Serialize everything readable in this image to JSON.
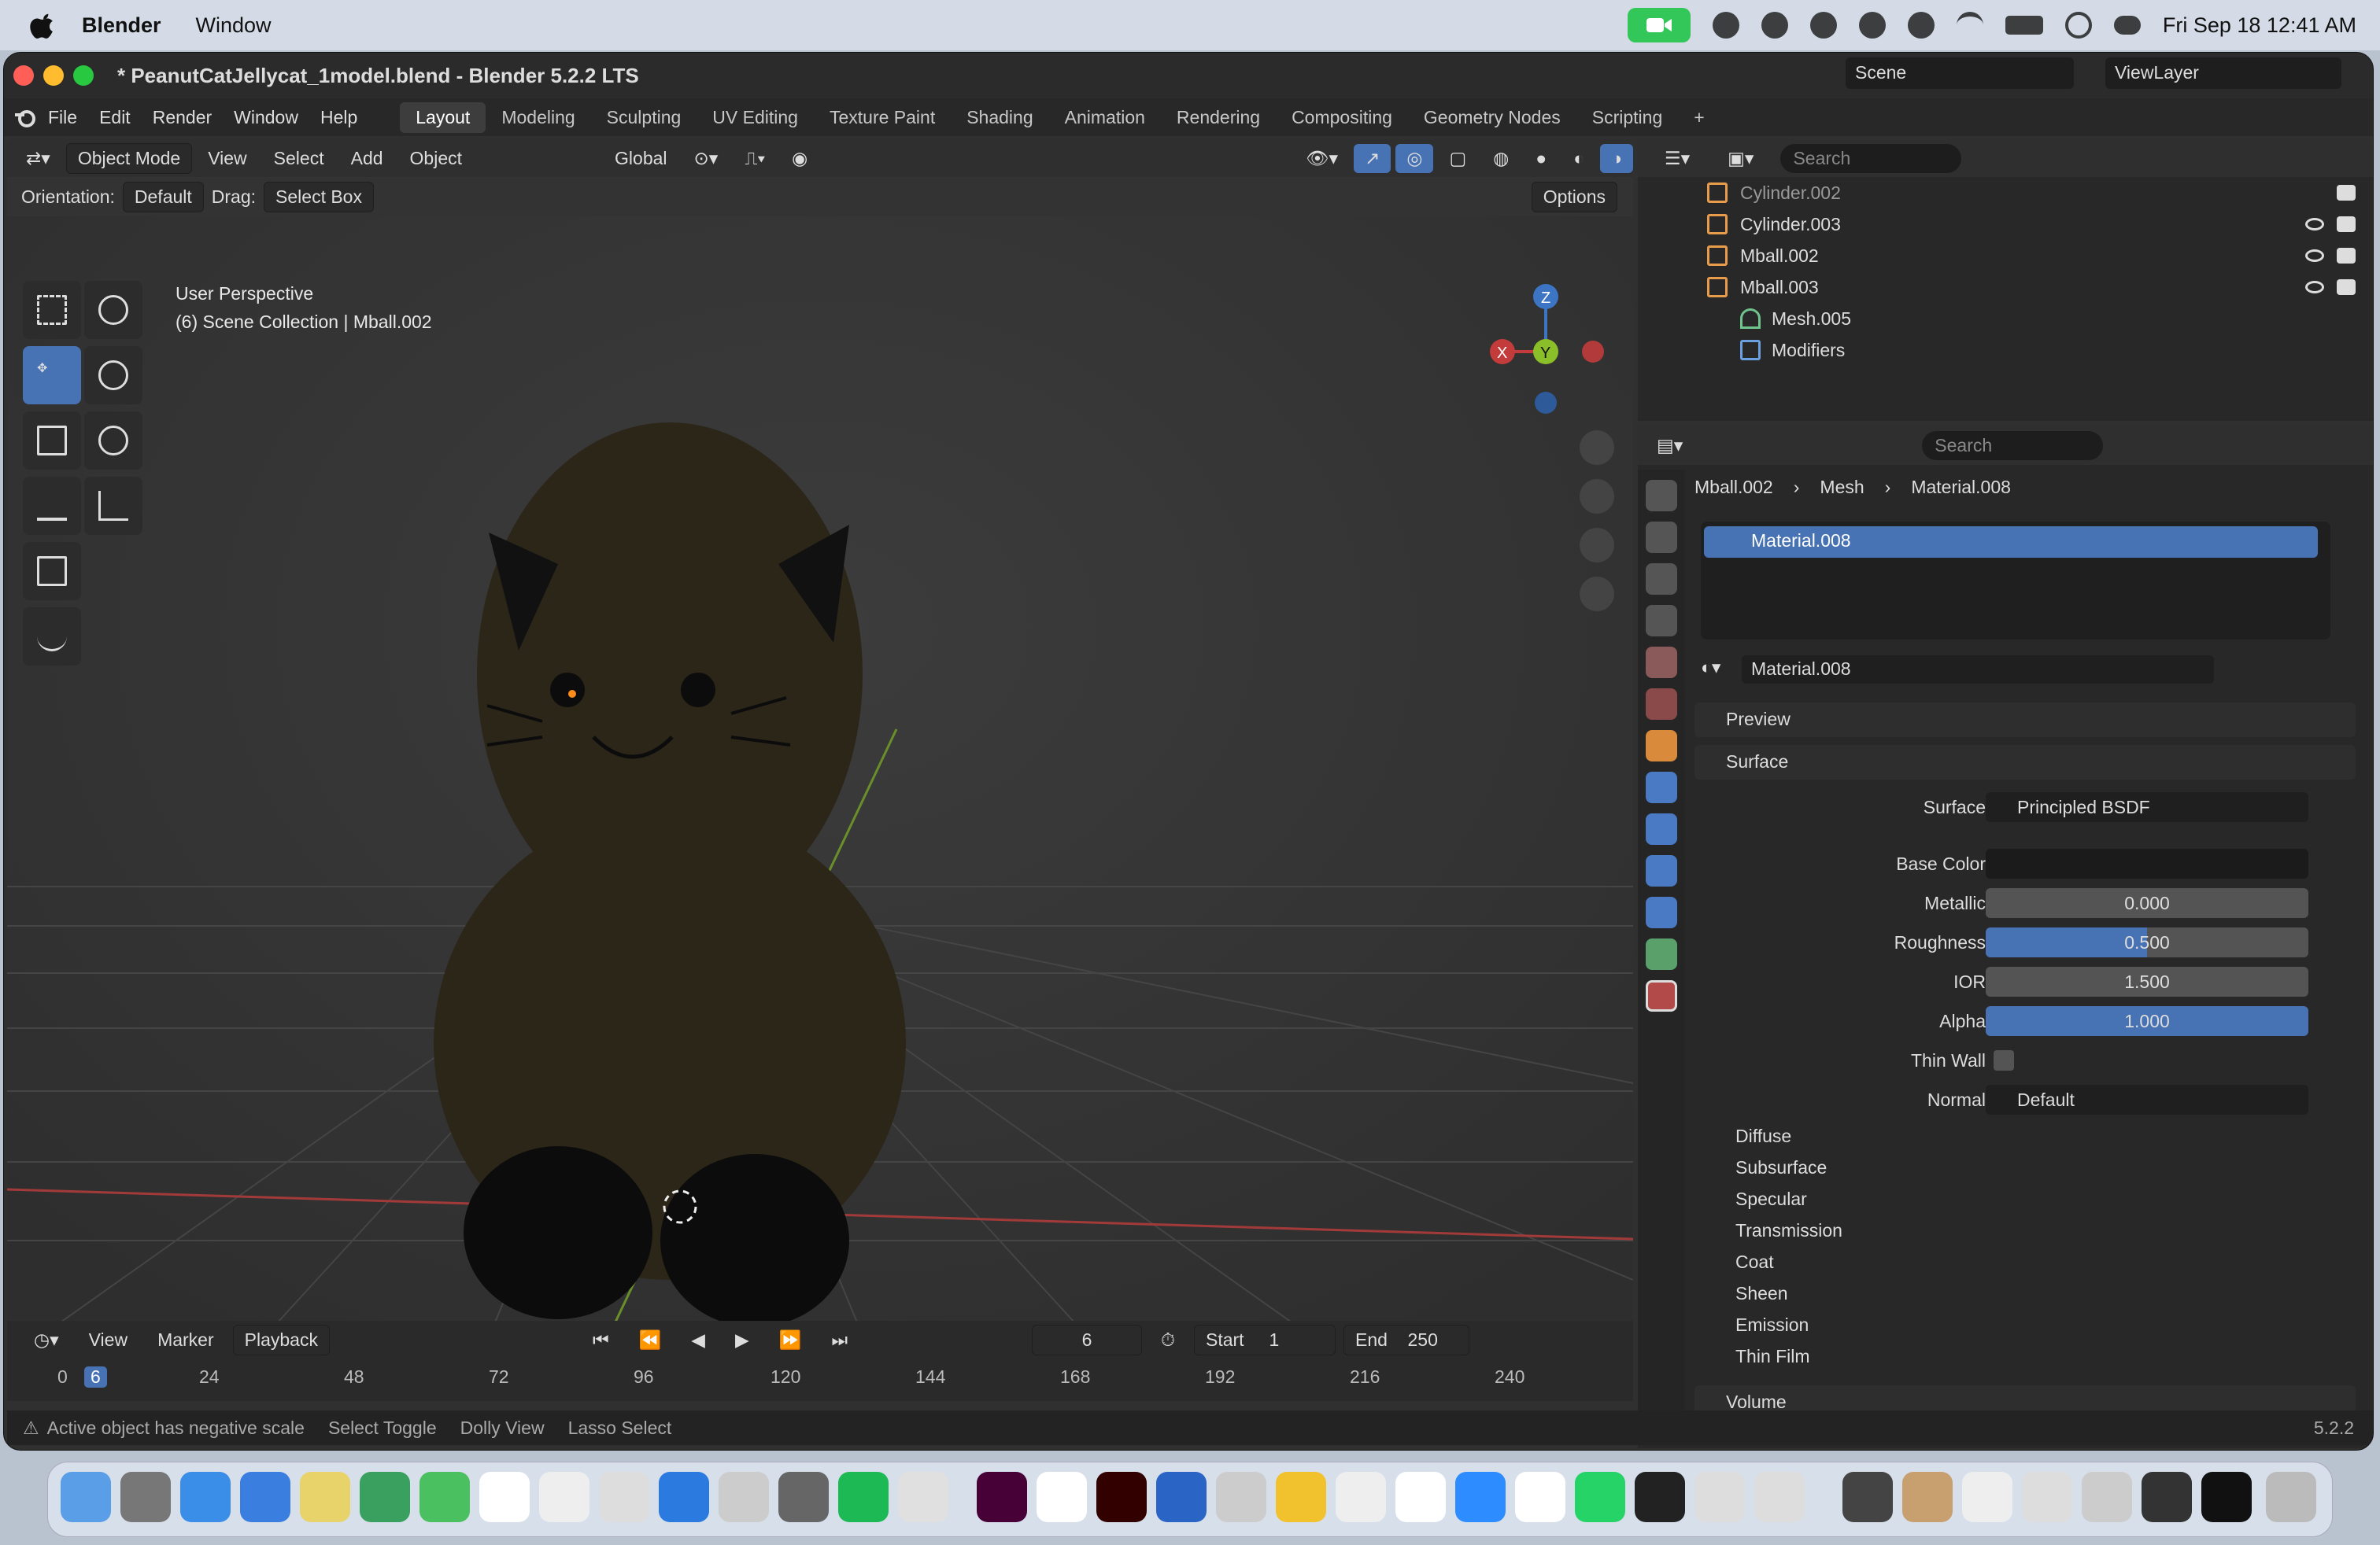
{
  "menubar": {
    "app_name": "Blender",
    "menu_window": "Window",
    "clock": "Fri Sep 18  12:41 AM"
  },
  "window": {
    "title": "* PeanutCatJellycat_1model.blend - Blender 5.2.2 LTS"
  },
  "topmenu": [
    "File",
    "Edit",
    "Render",
    "Window",
    "Help"
  ],
  "workspace_tabs": [
    "Layout",
    "Modeling",
    "Sculpting",
    "UV Editing",
    "Texture Paint",
    "Shading",
    "Animation",
    "Rendering",
    "Compositing",
    "Geometry Nodes",
    "Scripting"
  ],
  "active_tab": "Layout",
  "scene_name": "Scene",
  "view_layer": "ViewLayer",
  "viewport": {
    "mode": "Object Mode",
    "menus": [
      "View",
      "Select",
      "Add",
      "Object"
    ],
    "transform_orientation": "Global",
    "orientation_label": "Orientation:",
    "orientation_value": "Default",
    "drag_label": "Drag:",
    "drag_value": "Select Box",
    "options": "Options",
    "perspective": "User Perspective",
    "collection_info": "(6) Scene Collection | Mball.002",
    "axes": {
      "x": "X",
      "y": "Y",
      "z": "Z"
    }
  },
  "timeline": {
    "menus": [
      "View",
      "Marker"
    ],
    "playback": "Playback",
    "current_frame": "6",
    "start_label": "Start",
    "start_value": "1",
    "end_label": "End",
    "end_value": "250",
    "ticks": [
      "0",
      "6",
      "24",
      "48",
      "72",
      "96",
      "120",
      "144",
      "168",
      "192",
      "216",
      "240"
    ]
  },
  "statusbar": {
    "warning": "Active object has negative scale",
    "hint1": "Select Toggle",
    "hint2": "Dolly View",
    "hint3": "Lasso Select",
    "version": "5.2.2"
  },
  "outliner": {
    "search_placeholder": "Search",
    "rows": [
      {
        "name": "Cylinder.002"
      },
      {
        "name": "Cylinder.003"
      },
      {
        "name": "Mball.002"
      },
      {
        "name": "Mball.003"
      },
      {
        "name": "Mesh.005"
      },
      {
        "name": "Modifiers"
      }
    ]
  },
  "properties": {
    "search_placeholder": "Search",
    "breadcrumb": [
      "Mball.002",
      "Mesh",
      "Material.008"
    ],
    "material_slot": "Material.008",
    "material_name": "Material.008",
    "panels": {
      "preview": "Preview",
      "surface": "Surface",
      "volume": "Volume"
    },
    "surface": {
      "surface_label": "Surface",
      "surface_value": "Principled BSDF",
      "base_color_label": "Base Color",
      "metallic_label": "Metallic",
      "metallic_value": "0.000",
      "roughness_label": "Roughness",
      "roughness_value": "0.500",
      "ior_label": "IOR",
      "ior_value": "1.500",
      "alpha_label": "Alpha",
      "alpha_value": "1.000",
      "thinwall_label": "Thin Wall",
      "normal_label": "Normal",
      "normal_value": "Default"
    },
    "subpanels": [
      "Diffuse",
      "Subsurface",
      "Specular",
      "Transmission",
      "Coat",
      "Sheen",
      "Emission",
      "Thin Film"
    ]
  },
  "colors": {
    "accent": "#4772b3",
    "object_orange": "#e89b4a",
    "fur": "#2c2619"
  }
}
